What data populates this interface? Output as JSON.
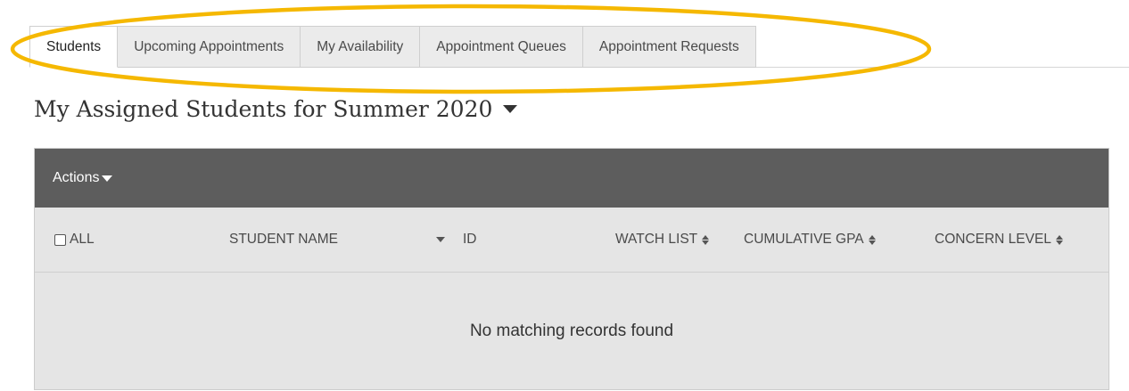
{
  "tabs": [
    {
      "label": "Students",
      "active": true
    },
    {
      "label": "Upcoming Appointments",
      "active": false
    },
    {
      "label": "My Availability",
      "active": false
    },
    {
      "label": "Appointment Queues",
      "active": false
    },
    {
      "label": "Appointment Requests",
      "active": false
    }
  ],
  "page": {
    "title": "My Assigned Students for Summer 2020"
  },
  "table": {
    "actions_label": "Actions",
    "columns": {
      "all": "ALL",
      "student_name": "STUDENT NAME",
      "id": "ID",
      "watch_list": "WATCH LIST",
      "cumulative_gpa": "CUMULATIVE GPA",
      "concern_level": "CONCERN LEVEL"
    },
    "empty_message": "No matching records found"
  },
  "colors": {
    "highlight": "#F5B800",
    "toolbar_bg": "#5D5D5D",
    "table_bg": "#E5E5E5"
  },
  "icons": [
    "caret-down-icon",
    "checkbox-icon",
    "sort-icon"
  ]
}
